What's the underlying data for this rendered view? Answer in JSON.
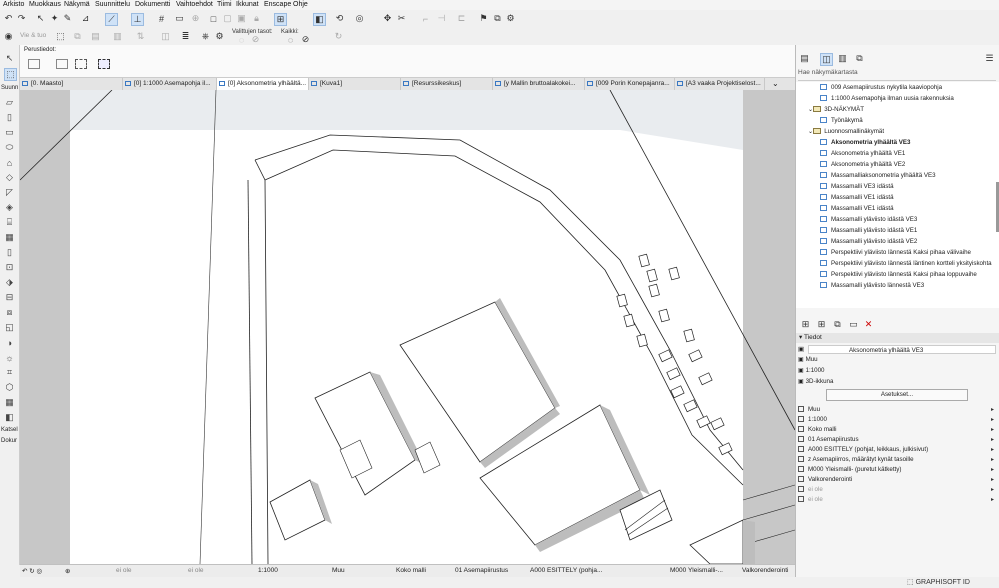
{
  "menu": [
    "Arkisto",
    "Muokkaus",
    "Näkymä",
    "Suunnittelu",
    "Dokumentti",
    "Vaihtoehdot",
    "Tiimi",
    "Ikkunat",
    "Enscape",
    "Ohje"
  ],
  "toolbar2": {
    "vie": "Vie & tuo",
    "valittujen": "Valittujen tasot:",
    "kaikki": "Kaikki:"
  },
  "infobox": {
    "label": "Perustiedot:"
  },
  "toolbox": {
    "suunnittelu": "Suunn",
    "katselu": "Katsel",
    "dokumentti": "Dokur"
  },
  "tabs": [
    {
      "label": "[0. Maasto]"
    },
    {
      "label": "[0] 1:1000 Asemapohja il..."
    },
    {
      "label": "[0] Aksonometria ylhäältä..."
    },
    {
      "label": "[Kuva1]"
    },
    {
      "label": "[Resurssikeskus]"
    },
    {
      "label": "[y Mallin bruttoalakokei..."
    },
    {
      "label": "[009 Porin Konepajanra..."
    },
    {
      "label": "[A3 vaaka Projektiselost..."
    }
  ],
  "navigator": {
    "search_placeholder": "Hae näkymäkartasta",
    "items": [
      {
        "label": "009 Asemapiirustus nykytila kaaviopohja"
      },
      {
        "label": "1:1000 Asemapohja ilman uusia rakennuksia"
      },
      {
        "label": "3D-NÄKYMÄT"
      },
      {
        "label": "Työnäkymä"
      },
      {
        "label": "Luonnosmallinäkymät"
      },
      {
        "label": "Aksonometria ylhäältä VE3"
      },
      {
        "label": "Aksonometria ylhäältä VE1"
      },
      {
        "label": "Aksonometria ylhäältä VE2"
      },
      {
        "label": "Massamalliaksonometria ylhäältä VE3"
      },
      {
        "label": "Massamalli VE3 idästä"
      },
      {
        "label": "Massamalli VE1 idästä"
      },
      {
        "label": "Massamalli VE1 idästä"
      },
      {
        "label": "Massamalli yläviisto idästä VE3"
      },
      {
        "label": "Massamalli yläviisto idästä VE1"
      },
      {
        "label": "Massamalli yläviisto idästä VE2"
      },
      {
        "label": "Perspektiivi yläviisto lännestä Kaksi pihaa välivaihe"
      },
      {
        "label": "Perspektiivi yläviisto lännestä läntinen kortteli yksityiskohta"
      },
      {
        "label": "Perspektiivi yläviisto lännestä Kaksi pihaa loppuvaihe"
      },
      {
        "label": "Massamalli yläviisto lännestä VE3"
      }
    ]
  },
  "tiedot": {
    "header": "Tiedot",
    "name_value": "Aksonometria ylhäältä VE3",
    "muu": "Muu",
    "scale": "1:1000",
    "window": "3D-ikkuna",
    "settings_button": "Asetukset...",
    "props": [
      {
        "label": "Muu"
      },
      {
        "label": "1:1000"
      },
      {
        "label": "Koko malli"
      },
      {
        "label": "01 Asemapiirustus"
      },
      {
        "label": "A000 ESITTELY (pohjat, leikkaus, julkisivut)"
      },
      {
        "label": "z Asemapiirros, määrätyt kynät tasoille"
      },
      {
        "label": "M000 Yleismalli- (puretut kätketty)"
      },
      {
        "label": "Valkorenderointi"
      },
      {
        "label": "ei ole"
      },
      {
        "label": "ei ole"
      }
    ]
  },
  "statusbar": {
    "ei_ole_1": "ei ole",
    "ei_ole_2": "ei ole",
    "scale": "1:1000",
    "muu": "Muu",
    "koko_malli": "Koko malli",
    "asemapiirustus": "01 Asemapiirustus",
    "esittely": "A000 ESITTELY (pohja...",
    "yleismalli": "M000 Yleismalli-...",
    "valkorenderointi": "Valkorenderointi"
  },
  "footer": {
    "brand": "GRAPHISOFT ID"
  }
}
